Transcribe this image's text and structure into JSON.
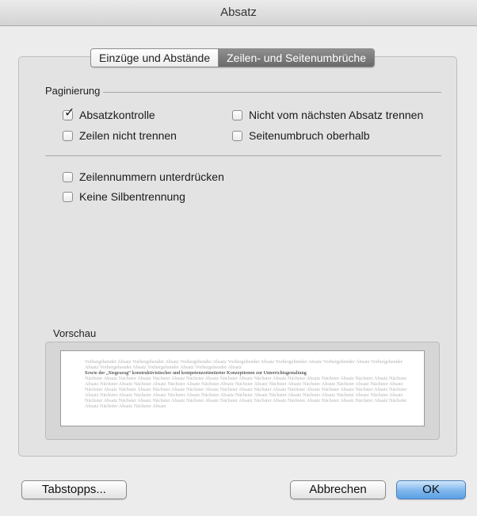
{
  "window": {
    "title": "Absatz"
  },
  "tabs": [
    {
      "label": "Einzüge und Abstände",
      "active": false
    },
    {
      "label": "Zeilen- und Seitenumbrüche",
      "active": true
    }
  ],
  "pagination": {
    "label": "Paginierung",
    "options": [
      {
        "label": "Absatzkontrolle",
        "checked": true
      },
      {
        "label": "Nicht vom nächsten Absatz trennen",
        "checked": false
      },
      {
        "label": "Zeilen nicht trennen",
        "checked": false
      },
      {
        "label": "Seitenumbruch oberhalb",
        "checked": false
      }
    ]
  },
  "other_options": [
    {
      "label": "Zeilennummern unterdrücken",
      "checked": false
    },
    {
      "label": "Keine Silbentrennung",
      "checked": false
    }
  ],
  "preview": {
    "label": "Vorschau",
    "preceding_text": "Vorhergehender Absatz Vorhergehender Absatz Vorhergehender Absatz Vorhergehender Absatz Vorhergehender Absatz Vorhergehender Absatz Vorhergehender Absatz Vorhergehender Absatz Vorhergehender Absatz Vorhergehender Absatz",
    "current_text": "Sowie der „Siegeszug“ konstruktivistischer und kompetenzorientierter Konzeptionen zur Unterrichtsgestaltung",
    "following_text": "Nächster Absatz Nächster Absatz Nächster Absatz Nächster Absatz Nächster Absatz Nächster Absatz Nächster Absatz Nächster Absatz Nächster Absatz Nächster Absatz Nächster Absatz Nächster Absatz Nächster Absatz Nächster Absatz Nächster Absatz Nächster Absatz Nächster Absatz Nächster Absatz Nächster Absatz Nächster Absatz Nächster Absatz Nächster Absatz Nächster Absatz Nächster Absatz Nächster Absatz Nächster Absatz Nächster Absatz Nächster Absatz Nächster Absatz Nächster Absatz Nächster Absatz Nächster Absatz Nächster Absatz Nächster Absatz Nächster Absatz Nächster Absatz Nächster Absatz Nächster Absatz Nächster Absatz Nächster Absatz Nächster Absatz Nächster Absatz Nächster Absatz Nächster Absatz Nächster Absatz Nächster Absatz Nächster Absatz Nächster Absatz Nächster Absatz Nächster Absatz"
  },
  "buttons": {
    "tabs_label": "Tabstopps...",
    "cancel_label": "Abbrechen",
    "ok_label": "OK"
  },
  "colors": {
    "default_button": "#6aa9ea",
    "active_tab": "#7a7a7a"
  }
}
